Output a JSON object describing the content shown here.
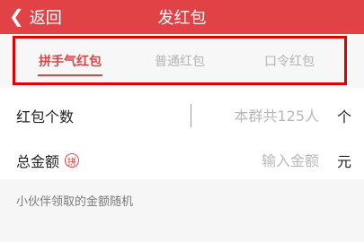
{
  "header": {
    "back_label": "返回",
    "title": "发红包"
  },
  "tabs": [
    {
      "label": "拼手气红包",
      "active": true
    },
    {
      "label": "普通红包",
      "active": false
    },
    {
      "label": "口令红包",
      "active": false
    }
  ],
  "form": {
    "count": {
      "label": "红包个数",
      "placeholder": "本群共125人",
      "unit": "个"
    },
    "total": {
      "label": "总金额",
      "badge": "拼",
      "placeholder": "输入金额",
      "unit": "元"
    }
  },
  "note": "小伙伴领取的金额随机",
  "colors": {
    "accent": "#e04246",
    "highlight_frame": "#e00000"
  }
}
